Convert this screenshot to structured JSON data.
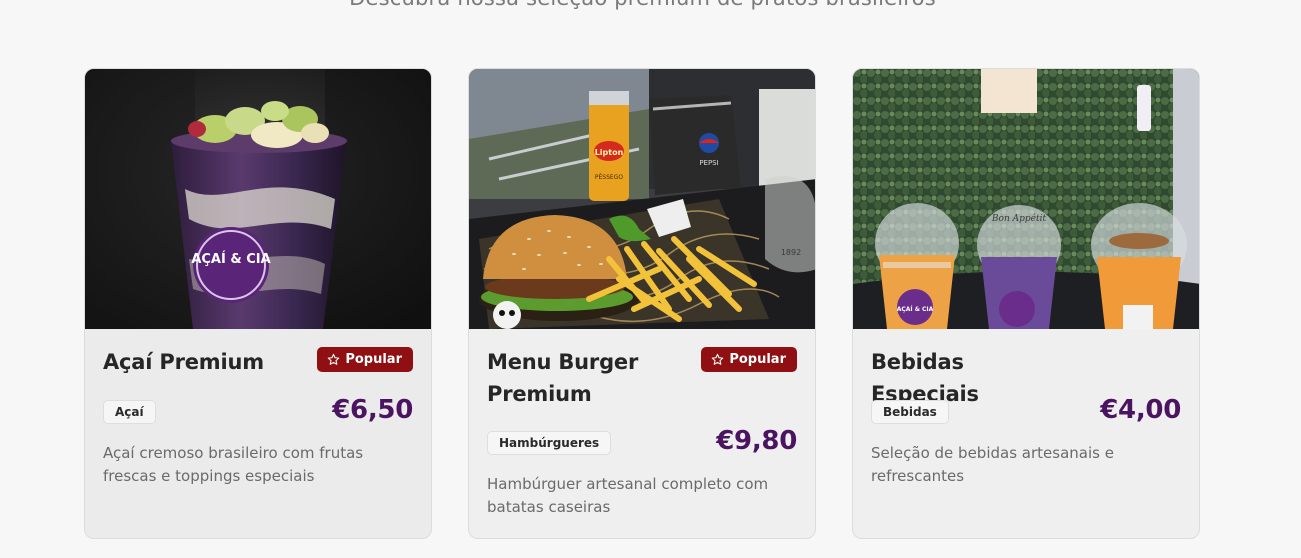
{
  "section": {
    "subtitle": "Descubra nossa seleção premium de pratos brasileiros"
  },
  "cards": [
    {
      "title": "Açaí Premium",
      "popular_label": "Popular",
      "category": "Açaí",
      "price": "€6,50",
      "description": "Açaí cremoso brasileiro com frutas frescas e toppings especiais",
      "image_logo_text": "AÇAÍ & CIA"
    },
    {
      "title": "Menu Burger Premium",
      "popular_label": "Popular",
      "category": "Hambúrgueres",
      "price": "€9,80",
      "description": "Hambúrguer artesanal completo com batatas caseiras",
      "image_can_text": "Lipton",
      "image_can_flavor": "PÊSSEGO",
      "image_cup_text": "PEPSI",
      "image_glass_text": "1892"
    },
    {
      "title": "Bebidas Especiais",
      "category": "Bebidas",
      "price": "€4,00",
      "description": "Seleção de bebidas artesanais e refrescantes",
      "image_lid_text": "Bon Appétit",
      "image_logo_text": "AÇAÍ & CIA"
    }
  ],
  "colors": {
    "popular_badge": "#8f0f12",
    "price": "#4b1460",
    "page_background": "#f7f7f7"
  },
  "icons": {
    "popular": "star-outline-icon"
  }
}
